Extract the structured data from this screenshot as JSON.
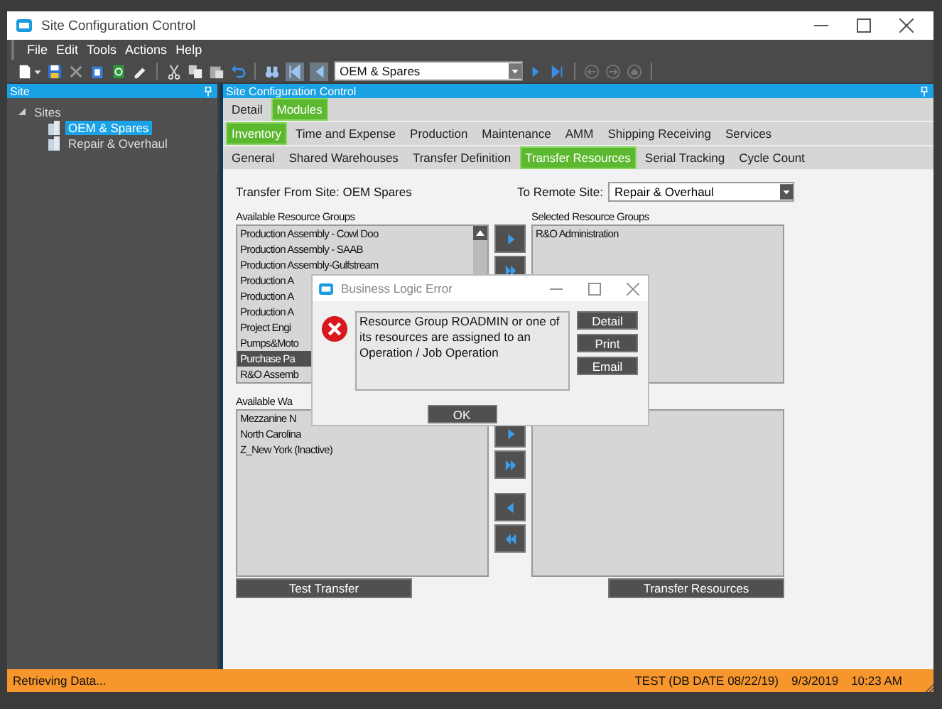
{
  "window": {
    "title": "Site Configuration Control"
  },
  "menu": [
    "File",
    "Edit",
    "Tools",
    "Actions",
    "Help"
  ],
  "toolbar": {
    "site_combo": "OEM & Spares"
  },
  "site_panel": {
    "title": "Site",
    "tree": [
      {
        "label": "Sites",
        "expanded": true,
        "children": [
          {
            "label": "OEM & Spares",
            "selected": true
          },
          {
            "label": "Repair & Overhaul",
            "selected": false
          }
        ]
      }
    ]
  },
  "main_panel": {
    "title": "Site Configuration Control",
    "tabs": [
      {
        "label": "Detail",
        "selected": false
      },
      {
        "label": "Modules",
        "selected": true
      }
    ],
    "module_tabs": [
      {
        "label": "Inventory",
        "selected": true
      },
      {
        "label": "Time and Expense",
        "selected": false
      },
      {
        "label": "Production",
        "selected": false
      },
      {
        "label": "Maintenance",
        "selected": false
      },
      {
        "label": "AMM",
        "selected": false
      },
      {
        "label": "Shipping Receiving",
        "selected": false
      },
      {
        "label": "Services",
        "selected": false
      }
    ],
    "inventory_tabs": [
      {
        "label": "General",
        "selected": false
      },
      {
        "label": "Shared Warehouses",
        "selected": false
      },
      {
        "label": "Transfer Definition",
        "selected": false
      },
      {
        "label": "Transfer Resources",
        "selected": true
      },
      {
        "label": "Serial Tracking",
        "selected": false
      },
      {
        "label": "Cycle Count",
        "selected": false
      }
    ]
  },
  "transfer": {
    "from_label": "Transfer From Site: OEM  Spares",
    "to_label": "To Remote Site:",
    "to_value": "Repair & Overhaul",
    "available_groups": {
      "label": "Available Resource Groups",
      "items": [
        {
          "text": "Production Assembly - Cowl Doo",
          "selected": false
        },
        {
          "text": "Production Assembly - SAAB",
          "selected": false
        },
        {
          "text": "Production Assembly-Gulfstream",
          "selected": false
        },
        {
          "text": "Production A",
          "selected": false
        },
        {
          "text": "Production A",
          "selected": false
        },
        {
          "text": "Production A",
          "selected": false
        },
        {
          "text": "Project Engi",
          "selected": false
        },
        {
          "text": "Pumps&Moto",
          "selected": false
        },
        {
          "text": "Purchase  Pa",
          "selected": true
        },
        {
          "text": "R&O Assemb",
          "selected": false
        }
      ]
    },
    "selected_groups": {
      "label": "Selected Resource Groups",
      "items": [
        {
          "text": "R&O Administration",
          "selected": false
        }
      ]
    },
    "available_warehouses": {
      "label": "Available Wa",
      "items": [
        {
          "text": "Mezzanine N",
          "selected": false
        },
        {
          "text": "North Carolina",
          "selected": false
        },
        {
          "text": "Z_New York (Inactive)",
          "selected": false
        }
      ]
    },
    "test_button": "Test Transfer",
    "transfer_button": "Transfer Resources"
  },
  "dialog": {
    "title": "Business Logic Error",
    "message": "Resource Group ROADMIN or one of its resources are assigned to an Operation / Job Operation",
    "side_buttons": [
      "Detail",
      "Print",
      "Email"
    ],
    "ok_button": "OK"
  },
  "status_bar": {
    "message": "Retrieving Data...",
    "environment": "TEST (DB DATE 08/22/19)",
    "date": "9/3/2019",
    "time": "10:23 AM"
  }
}
